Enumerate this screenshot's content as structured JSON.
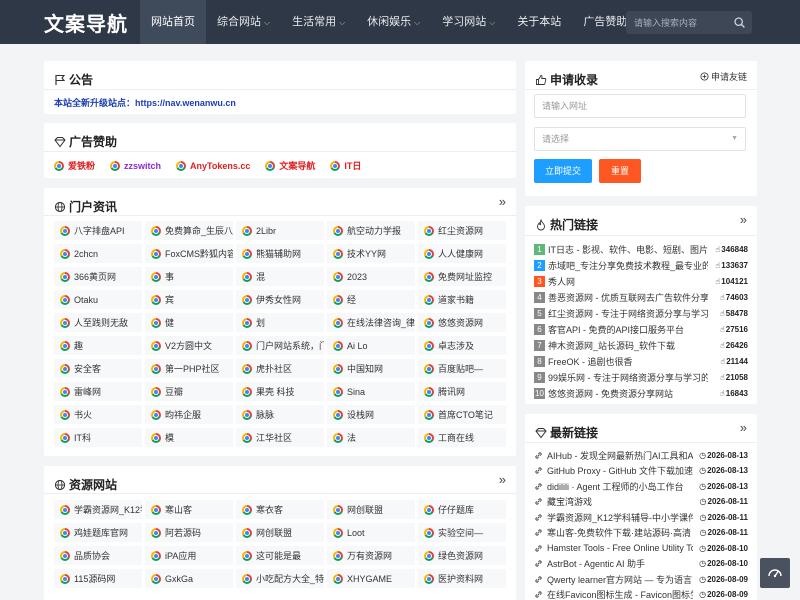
{
  "header": {
    "logo": "文案导航",
    "nav": [
      {
        "label": "网站首页",
        "active": true,
        "caret": false
      },
      {
        "label": "综合网站",
        "caret": true
      },
      {
        "label": "生活常用",
        "caret": true
      },
      {
        "label": "休闲娱乐",
        "caret": true
      },
      {
        "label": "学习网站",
        "caret": true
      },
      {
        "label": "关于本站",
        "caret": false
      },
      {
        "label": "广告赞助",
        "caret": false
      }
    ],
    "search_placeholder": "请输入搜索内容"
  },
  "notice": {
    "title": "公告",
    "text": "本站全新升级站点：https://nav.wenanwu.cn"
  },
  "ads": {
    "title": "广告赞助",
    "items": [
      {
        "label": "爱铁粉",
        "color": "#e02020"
      },
      {
        "label": "zzswitch",
        "color": "#8a2ad6"
      },
      {
        "label": "AnyTokens.cc",
        "color": "#e02020"
      },
      {
        "label": "文案导航",
        "color": "#e02020"
      },
      {
        "label": "IT日",
        "color": "#e02020"
      }
    ]
  },
  "portal": {
    "title": "门户资讯",
    "items": [
      "八字排盘API",
      "免费算命_生辰八字",
      "2Libr",
      "航空动力学报",
      "红尘资源网",
      "2chcn",
      "FoxCMS黔狐内容管",
      "熊猫辅助网",
      "技术YY网",
      "人人健康网",
      "366黄页网",
      "事",
      "混",
      "2023",
      "免费网址监控",
      "Otaku",
      "宾",
      "伊秀女性网",
      "经",
      "道家书籍",
      "人至践则无敌",
      "健",
      "划",
      "在线法律咨询_律師",
      "悠悠资源网",
      "趣",
      "V2方圆中文",
      "门户网站系统，门",
      "Ai Lo",
      "卓志涉及",
      "安全客",
      "第一PHP社区",
      "虎扑社区",
      "中国知网",
      "百度贴吧—",
      "雷峰网",
      "豆瓣",
      "果壳 科技",
      "Sina",
      "腾讯网",
      "书火",
      "昀祎企服",
      "脉脉",
      "设栈网",
      "首席CTO笔记",
      "IT科",
      "模",
      "江华社区",
      "法",
      "工商在线"
    ]
  },
  "resource": {
    "title": "资源网站",
    "items": [
      "学霸资源网_K12学",
      "寒山客",
      "寒衣客",
      "网创联盟",
      "仔仔题库",
      "鸡娃题库官网",
      "阿若源码",
      "网创联盟",
      "Loot",
      "实验空间—",
      "品质协会",
      "iPA应用",
      "这可能是最",
      "万有资源网",
      "绿色资源网",
      "115源码网",
      "GxkGa",
      "小吃配方大全_特色",
      "XHYGAME",
      "医护资料网"
    ]
  },
  "apply": {
    "title": "申请收录",
    "friend_link": "申请友链",
    "url_placeholder": "请输入网址",
    "select_placeholder": "请选择",
    "submit": "立即提交",
    "reset": "重置"
  },
  "hot": {
    "title": "热门链接",
    "items": [
      {
        "num": "1",
        "title": "IT日志 - 影视、软件、电影、短剧、图片",
        "count": "346848",
        "color": "#5fb878"
      },
      {
        "num": "2",
        "title": "赤域吧_专注分享免费技术教程_最专业的",
        "count": "133637",
        "color": "#1e9fff"
      },
      {
        "num": "3",
        "title": "秀人网",
        "count": "104121",
        "color": "#ff5722"
      },
      {
        "num": "4",
        "title": "善恶资源网 - 优质互联网去广告软件分享",
        "count": "74603",
        "color": "#888888"
      },
      {
        "num": "5",
        "title": "红尘资源网 - 专注于网络资源分享与学习的",
        "count": "58478",
        "color": "#888888"
      },
      {
        "num": "6",
        "title": "客官API - 免费的API接口服务平台",
        "count": "27516",
        "color": "#888888"
      },
      {
        "num": "7",
        "title": "神木资源网_站长源码_软件下载",
        "count": "26426",
        "color": "#888888"
      },
      {
        "num": "8",
        "title": "FreeOK - 追剧也很香",
        "count": "21144",
        "color": "#888888"
      },
      {
        "num": "9",
        "title": "99娱乐网 - 专注于网络资源分享与学习的",
        "count": "21058",
        "color": "#888888"
      },
      {
        "num": "10",
        "title": "悠悠资源网 - 免费资源分享网站",
        "count": "16843",
        "color": "#888888"
      }
    ]
  },
  "latest": {
    "title": "最新链接",
    "items": [
      {
        "title": "AIHub - 发现全网最新热门AI工具和AI",
        "date": "2026-08-13"
      },
      {
        "title": "GitHub Proxy - GitHub 文件下载加速",
        "date": "2026-08-13"
      },
      {
        "title": "didilili · Agent 工程师的小岛工作台",
        "date": "2026-08-13"
      },
      {
        "title": "藏宝湾游戏",
        "date": "2026-08-11"
      },
      {
        "title": "学霸资源网_K12学科辅导-中小学课件",
        "date": "2026-08-11"
      },
      {
        "title": "寒山客-免费软件下载·建站源码·高清",
        "date": "2026-08-11"
      },
      {
        "title": "Hamster Tools - Free Online Utility To",
        "date": "2026-08-10"
      },
      {
        "title": "AstrBot - Agentic AI 助手",
        "date": "2026-08-10"
      },
      {
        "title": "Qwerty learner官方网站 — 专为语言",
        "date": "2026-08-09"
      },
      {
        "title": "在线Favicon图标生成 - Favicon图标生",
        "date": "2026-08-09"
      }
    ]
  }
}
